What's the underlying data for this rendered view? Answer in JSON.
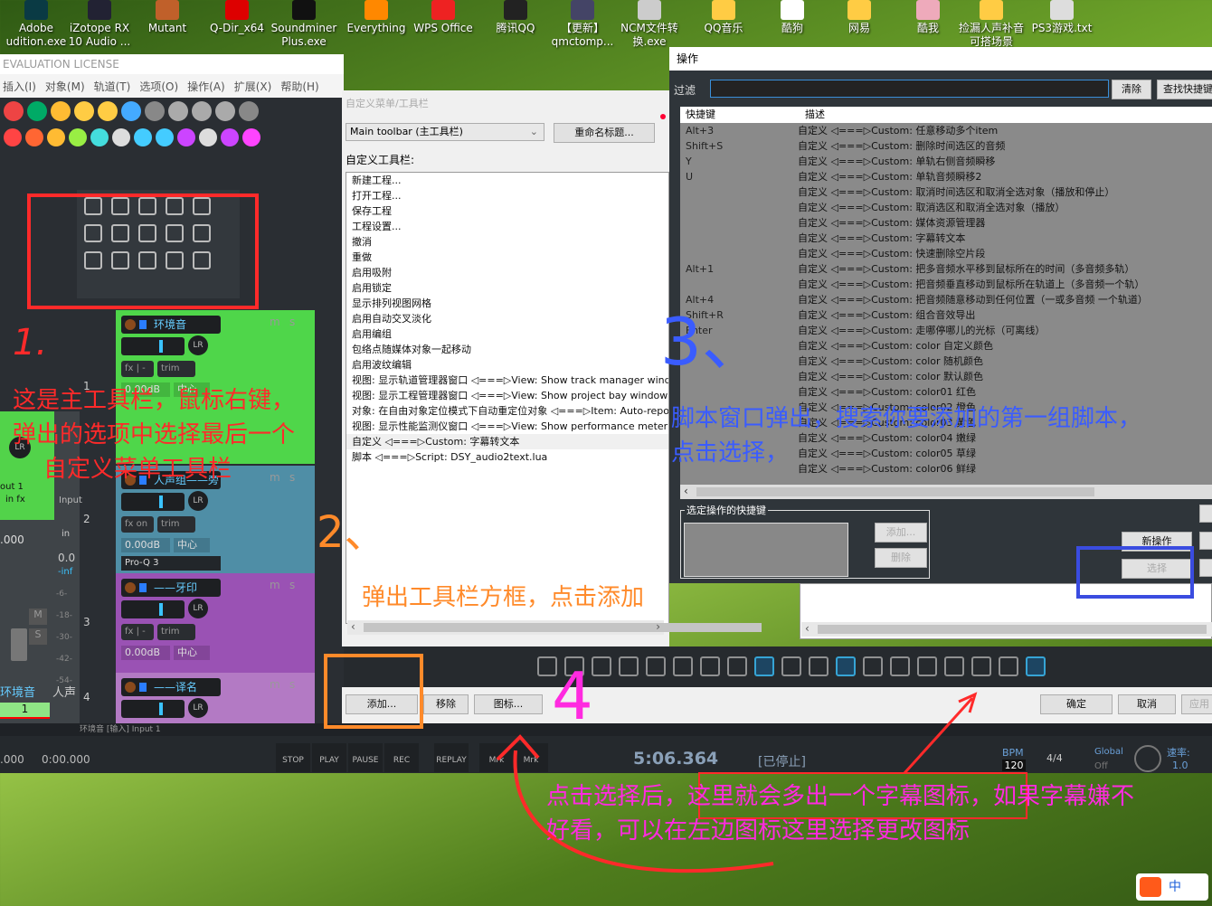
{
  "desktop": {
    "icons": [
      {
        "label": "Adobe\nudition.exe"
      },
      {
        "label": "iZotope RX\n10 Audio ..."
      },
      {
        "label": "Mutant"
      },
      {
        "label": "Q-Dir_x64"
      },
      {
        "label": "Soundminer\nPlus.exe"
      },
      {
        "label": "Everything"
      },
      {
        "label": "WPS Office"
      },
      {
        "label": "腾讯QQ"
      },
      {
        "label": "【更新】\nqmctomp..."
      },
      {
        "label": "NCM文件转\n换.exe"
      },
      {
        "label": "QQ音乐"
      },
      {
        "label": "酷狗"
      },
      {
        "label": "网易"
      },
      {
        "label": "酷我"
      },
      {
        "label": "捡漏人声补音\n可搭场景"
      },
      {
        "label": "PS3游戏.txt"
      }
    ]
  },
  "reaper": {
    "title": "EVALUATION LICENSE",
    "menu": [
      "插入(I)",
      "对象(M)",
      "轨道(T)",
      "选项(O)",
      "操作(A)",
      "扩展(X)",
      "帮助(H)"
    ],
    "tracks": [
      {
        "num": "1",
        "name": "环境音",
        "volume": "0.00dB",
        "pan": "中心",
        "color": "#4fd64a"
      },
      {
        "num": "2",
        "name": "人声组——旁白",
        "volume": "0.00dB",
        "pan": "中心",
        "fx": "on",
        "plugin": "Pro-Q 3",
        "color": "#4f8ea6"
      },
      {
        "num": "3",
        "name": "——牙印",
        "volume": "0.00dB",
        "pan": "中心",
        "color": "#9a52b4"
      },
      {
        "num": "4",
        "name": "——译名",
        "color": "#b37ac4"
      }
    ],
    "fx_label": "fx",
    "trim_label": "trim",
    "lr_label": "LR",
    "m_label": "m",
    "s_label": "s",
    "mixer": {
      "in_fx": "in fx",
      "out": "out 1",
      "input": "Input",
      "in": "in",
      "value": "0.0",
      "inf": "-inf",
      "scale": [
        "-6-",
        "-18-",
        "-30-",
        "-42-",
        "-54-"
      ],
      "track_label": "环境音",
      "track_label2": "人声",
      "master_num": "1",
      "time_left": ".000",
      "time_left2": "0:00.000"
    },
    "status_line": "环境音 [输入] Input 1"
  },
  "custom_dialog": {
    "title": "自定义菜单/工具栏",
    "toolbar_select": "Main toolbar (主工具栏)",
    "rename_button": "重命名标题...",
    "list_label": "自定义工具栏:",
    "items": [
      "新建工程...",
      "打开工程...",
      "保存工程",
      "工程设置...",
      "撤消",
      "重做",
      "启用吸附",
      "启用锁定",
      "显示排列视图网格",
      "启用自动交叉淡化",
      "启用编组",
      "包络点随媒体对象一起移动",
      "启用波纹编辑",
      "视图: 显示轨道管理器窗口 ◁===▷View: Show track manager window",
      "视图: 显示工程管理器窗口 ◁===▷View: Show project bay window",
      "对象: 在自由对象定位模式下自动重定位对象 ◁===▷Item: Auto-reposition",
      "视图: 显示性能监测仪窗口 ◁===▷View: Show performance meter window",
      "自定义 ◁===▷Custom: 字幕转文本",
      "脚本 ◁===▷Script: DSY_audio2text.lua"
    ],
    "selected_index": 17,
    "add_button": "添加...",
    "remove_button": "移除",
    "icon_button": "图标...",
    "ok_button": "确定",
    "cancel_button": "取消",
    "apply_button": "应用"
  },
  "actions": {
    "title": "操作",
    "filter_label": "过滤",
    "filter_value": "",
    "clear_button": "清除",
    "find_shortcut_button": "查找快捷键",
    "col_shortcut": "快捷键",
    "col_desc": "描述",
    "rows": [
      {
        "key": "Alt+3",
        "desc": "自定义 ◁===▷Custom: 任意移动多个item"
      },
      {
        "key": "Shift+S",
        "desc": "自定义 ◁===▷Custom: 删除时间选区的音频"
      },
      {
        "key": "Y",
        "desc": "自定义 ◁===▷Custom: 单轨右侧音频瞬移"
      },
      {
        "key": "U",
        "desc": "自定义 ◁===▷Custom: 单轨音频瞬移2"
      },
      {
        "key": "",
        "desc": "自定义 ◁===▷Custom: 取消时间选区和取消全选对象（播放和停止）"
      },
      {
        "key": "",
        "desc": "自定义 ◁===▷Custom: 取消选区和取消全选对象（播放）"
      },
      {
        "key": "",
        "desc": "自定义 ◁===▷Custom: 媒体资源管理器"
      },
      {
        "key": "",
        "desc": "自定义 ◁===▷Custom: 字幕转文本"
      },
      {
        "key": "",
        "desc": "自定义 ◁===▷Custom: 快速删除空片段"
      },
      {
        "key": "Alt+1",
        "desc": "自定义 ◁===▷Custom: 把多音频水平移到鼠标所在的时间（多音频多轨）"
      },
      {
        "key": "",
        "desc": "自定义 ◁===▷Custom: 把音频垂直移动到鼠标所在轨道上（多音频一个轨）"
      },
      {
        "key": "Alt+4",
        "desc": "自定义 ◁===▷Custom: 把音频随意移动到任何位置（一或多音频 一个轨道）"
      },
      {
        "key": "Shift+R",
        "desc": "自定义 ◁===▷Custom: 组合音效导出"
      },
      {
        "key": "Enter",
        "desc": "自定义 ◁===▷Custom: 走哪停哪儿的光标（可离线）"
      },
      {
        "key": "",
        "desc": "自定义 ◁===▷Custom: color 自定义颜色"
      },
      {
        "key": "",
        "desc": "自定义 ◁===▷Custom: color 随机颜色"
      },
      {
        "key": "",
        "desc": "自定义 ◁===▷Custom: color 默认颜色"
      },
      {
        "key": "",
        "desc": "自定义 ◁===▷Custom: color01 红色"
      },
      {
        "key": "",
        "desc": "自定义 ◁===▷Custom: color02 橙色"
      },
      {
        "key": "",
        "desc": "自定义 ◁===▷Custom: color03 黄色"
      },
      {
        "key": "",
        "desc": "自定义 ◁===▷Custom: color04 嫩绿"
      },
      {
        "key": "",
        "desc": "自定义 ◁===▷Custom: color05 草绿"
      },
      {
        "key": "",
        "desc": "自定义 ◁===▷Custom: color06 鲜绿"
      }
    ],
    "shortcut_group": "选定操作的快捷键",
    "sc_add_button": "添加...",
    "sc_delete_button": "删除",
    "new_action_button": "新操作",
    "select_button": "选择"
  },
  "transport": {
    "buttons": [
      "STOP",
      "PLAY",
      "PAUSE",
      "REC",
      "REPLAY",
      "Mrk",
      "Mrk"
    ],
    "time": "5:06.364",
    "state": "[已停止]",
    "bpm_label": "BPM",
    "bpm": "120",
    "signature": "4/4",
    "global_label": "Global",
    "global_value": "Off",
    "rate_label": "速率:",
    "rate_value": "1.0"
  },
  "annotations": {
    "n1": "1.",
    "n1_text": [
      "这是主工具栏，鼠标右键，",
      "弹出的选项中选择最后一个",
      "自定义菜单工具栏"
    ],
    "n2": "2、",
    "n2_text": "弹出工具栏方框，点击添加",
    "n3": "3、",
    "n3_text": [
      "脚本窗口弹出，搜索你要添加的第一组脚本，",
      "点击选择，"
    ],
    "n4": "4",
    "n4_text": [
      "点击选择后，这里就会多出一个字幕图标，如果字幕嫌不",
      "好看，可以在左边图标这里选择更改图标"
    ]
  },
  "colors": {
    "red_note": "#ff2a2a",
    "blue_note": "#3a5cff",
    "orange_note": "#ff8a2a",
    "magenta_note": "#ff2ae0"
  },
  "taskbar": {
    "ime": "中"
  }
}
